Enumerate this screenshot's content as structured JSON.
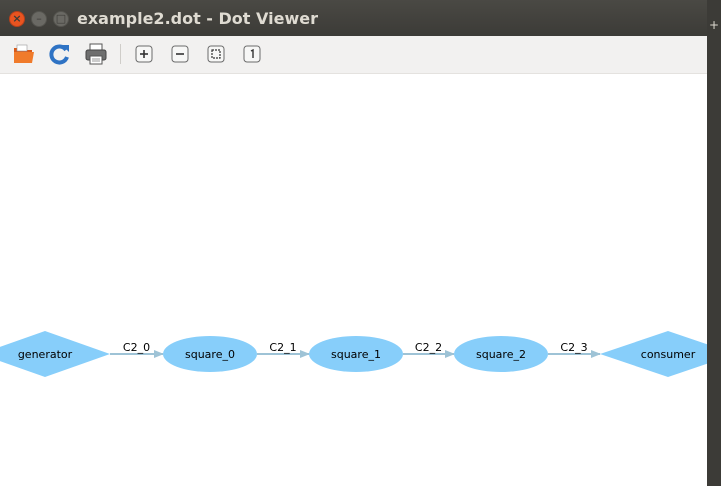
{
  "window": {
    "title": "example2.dot - Dot Viewer",
    "close_glyph": "×",
    "min_glyph": "–",
    "max_glyph": "□"
  },
  "toolbar": {
    "icons": [
      "open-icon",
      "reload-icon",
      "print-icon",
      "zoom-in-icon",
      "zoom-out-icon",
      "zoom-fit-icon",
      "zoom-100-icon"
    ]
  },
  "graph": {
    "nodes": [
      {
        "id": "generator",
        "label": "generator",
        "shape": "diamond"
      },
      {
        "id": "square_0",
        "label": "square_0",
        "shape": "ellipse"
      },
      {
        "id": "square_1",
        "label": "square_1",
        "shape": "ellipse"
      },
      {
        "id": "square_2",
        "label": "square_2",
        "shape": "ellipse"
      },
      {
        "id": "consumer",
        "label": "consumer",
        "shape": "diamond"
      }
    ],
    "edges": [
      {
        "from": "generator",
        "to": "square_0",
        "label": "C2_0"
      },
      {
        "from": "square_0",
        "to": "square_1",
        "label": "C2_1"
      },
      {
        "from": "square_1",
        "to": "square_2",
        "label": "C2_2"
      },
      {
        "from": "square_2",
        "to": "consumer",
        "label": "C2_3"
      }
    ],
    "colors": {
      "node_fill": "#87cefa",
      "edge": "#9ec3d6"
    }
  },
  "right_strip": {
    "glyph": "+"
  }
}
